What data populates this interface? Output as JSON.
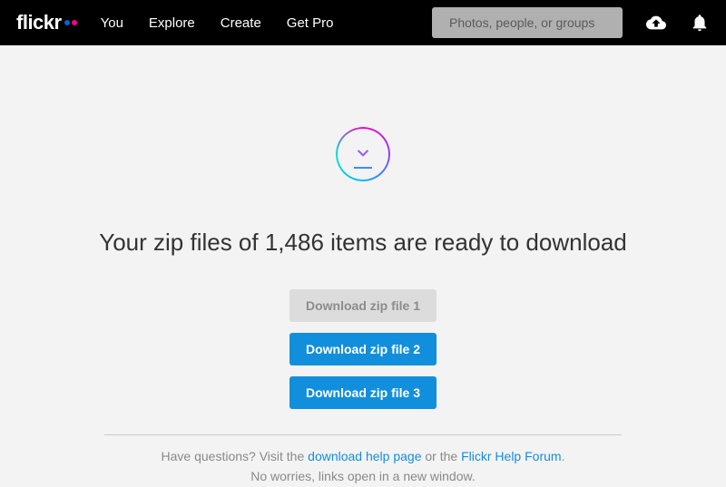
{
  "nav": {
    "logo_text": "flickr",
    "links": [
      "You",
      "Explore",
      "Create",
      "Get Pro"
    ]
  },
  "search": {
    "placeholder": "Photos, people, or groups"
  },
  "main": {
    "headline": "Your zip files of 1,486 items are ready to download",
    "buttons": [
      {
        "label": "Download zip file 1",
        "disabled": true
      },
      {
        "label": "Download zip file 2",
        "disabled": false
      },
      {
        "label": "Download zip file 3",
        "disabled": false
      }
    ]
  },
  "help": {
    "prefix": "Have questions? Visit the ",
    "link1": "download help page",
    "middle": " or the ",
    "link2": "Flickr Help Forum",
    "suffix": ".",
    "line2": "No worries, links open in a new window."
  }
}
